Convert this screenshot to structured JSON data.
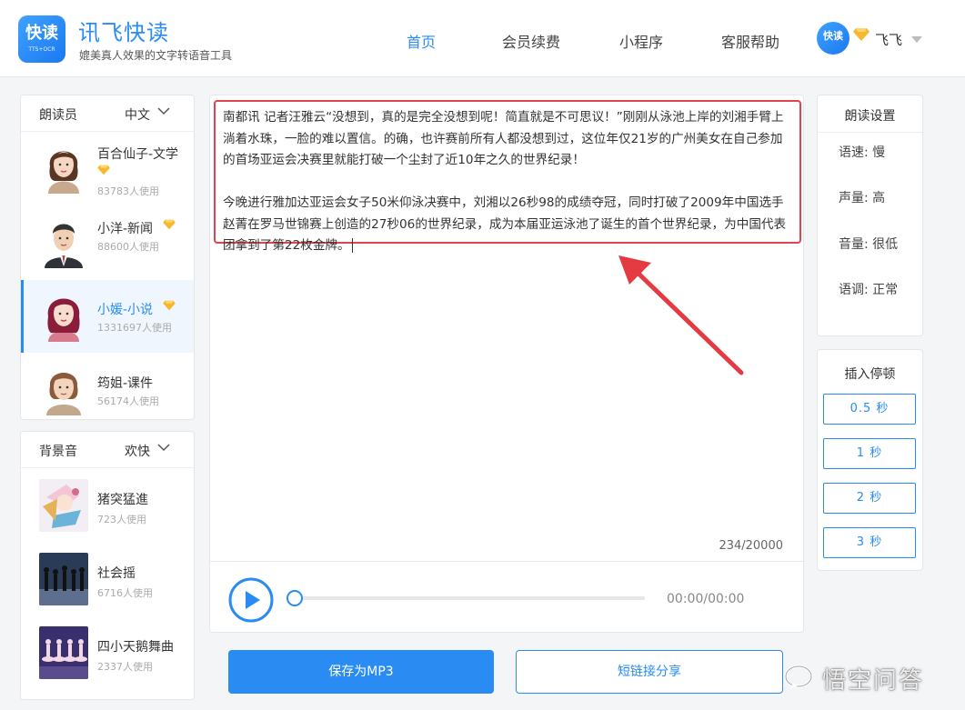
{
  "header": {
    "logo_text": "快读",
    "logo_sub": "TTS+OCR",
    "brand": "讯飞快读",
    "tagline": "媲美真人效果的文字转语音工具",
    "nav": [
      {
        "label": "首页",
        "active": true
      },
      {
        "label": "会员续费",
        "active": false
      },
      {
        "label": "小程序",
        "active": false
      },
      {
        "label": "客服帮助",
        "active": false
      }
    ],
    "user_avatar_text": "快读",
    "user_name": "飞飞"
  },
  "voices": {
    "title": "朗读员",
    "language": "中文",
    "items": [
      {
        "name": "百合仙子-文学",
        "usage": "83783人使用",
        "vip": true
      },
      {
        "name": "小洋-新闻",
        "usage": "88600人使用",
        "vip": true
      },
      {
        "name": "小媛-小说",
        "usage": "1331697人使用",
        "vip": true,
        "active": true
      },
      {
        "name": "筠姐-课件",
        "usage": "56174人使用",
        "vip": false
      }
    ]
  },
  "music": {
    "title": "背景音",
    "mood": "欢快",
    "items": [
      {
        "name": "猪突猛進",
        "usage": "723人使用"
      },
      {
        "name": "社会摇",
        "usage": "6716人使用"
      },
      {
        "name": "四小天鹅舞曲",
        "usage": "2337人使用"
      }
    ]
  },
  "editor": {
    "paragraph1": "南都讯 记者汪雅云“没想到，真的是完全没想到呢！简直就是不可思议！”刚刚从泳池上岸的刘湘手臂上淌着水珠，一脸的难以置信。的确，也许赛前所有人都没想到过，这位年仅21岁的广州美女在自己参加的首场亚运会决赛里就能打破一个尘封了近10年之久的世界纪录！",
    "paragraph2": "今晚进行雅加达亚运会女子50米仰泳决赛中，刘湘以26秒98的成绩夺冠，同时打破了2009年中国选手赵菁在罗马世锦赛上创造的27秒06的世界纪录，成为本届亚运泳池了诞生的首个世界纪录，为中国代表团拿到了第22枚金牌。",
    "counter": "234/20000",
    "time": "00:00/00:00",
    "progress": 0
  },
  "actions": {
    "save": "保存为MP3",
    "share": "短链接分享"
  },
  "settings": {
    "title": "朗读设置",
    "speed": "语速: 慢",
    "volume_level": "声量: 高",
    "pitch": "音量: 很低",
    "tone": "语调: 正常"
  },
  "pauses": {
    "title": "插入停顿",
    "items": [
      "0.5 秒",
      "1 秒",
      "2 秒",
      "3 秒"
    ]
  },
  "watermark": "悟空问答",
  "colors": {
    "accent": "#2a8cf2",
    "highlight_border": "#e0454f",
    "gem": "#f5b82e"
  }
}
